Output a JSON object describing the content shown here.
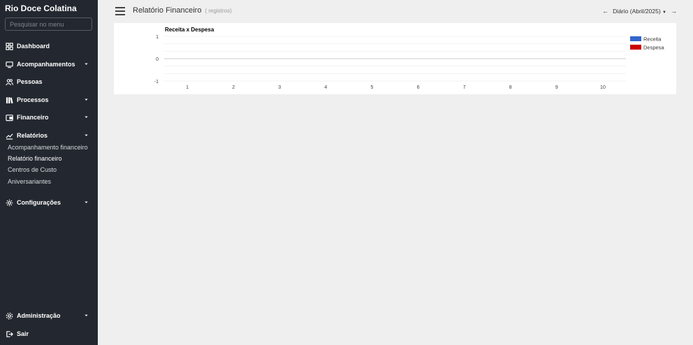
{
  "app": {
    "brand": "Rio Doce Colatina"
  },
  "search": {
    "placeholder": "Pesquisar no menu"
  },
  "sidebar": {
    "items": [
      {
        "label": "Dashboard"
      },
      {
        "label": "Acompanhamentos"
      },
      {
        "label": "Pessoas"
      },
      {
        "label": "Processos"
      },
      {
        "label": "Financeiro"
      },
      {
        "label": "Relatórios"
      },
      {
        "label": "Configurações"
      }
    ],
    "sub_items": [
      {
        "label": "Acompanhamento financeiro"
      },
      {
        "label": "Relatório financeiro"
      },
      {
        "label": "Centros de Custo"
      },
      {
        "label": "Aniversariantes"
      }
    ],
    "bottom": [
      {
        "label": "Administração"
      },
      {
        "label": "Sair"
      }
    ]
  },
  "header": {
    "title": "Relatório Financeiro",
    "subtitle": "( registros)",
    "period": "Diário (Abril/2025)",
    "prev_icon": "arrow-left-icon",
    "next_icon": "arrow-right-icon"
  },
  "colors": {
    "sidebar_bg": "#232830",
    "receita": "#3366cc",
    "despesa": "#cc0000"
  },
  "chart_data": {
    "type": "bar",
    "title": "Receita x Despesa",
    "categories": [
      "1",
      "2",
      "3",
      "4",
      "5",
      "6",
      "7",
      "8",
      "9",
      "10"
    ],
    "y_ticks": [
      "1",
      "0",
      "-1"
    ],
    "ylim": [
      -1,
      1
    ],
    "series": [
      {
        "name": "Receita",
        "color": "#3366cc",
        "values": [
          0,
          0,
          0,
          0,
          0,
          0,
          0,
          0,
          0,
          0
        ]
      },
      {
        "name": "Despesa",
        "color": "#cc0000",
        "values": [
          0,
          0,
          0,
          0,
          0,
          0,
          0,
          0,
          0,
          0
        ]
      }
    ],
    "legend": "right",
    "grid": true
  }
}
